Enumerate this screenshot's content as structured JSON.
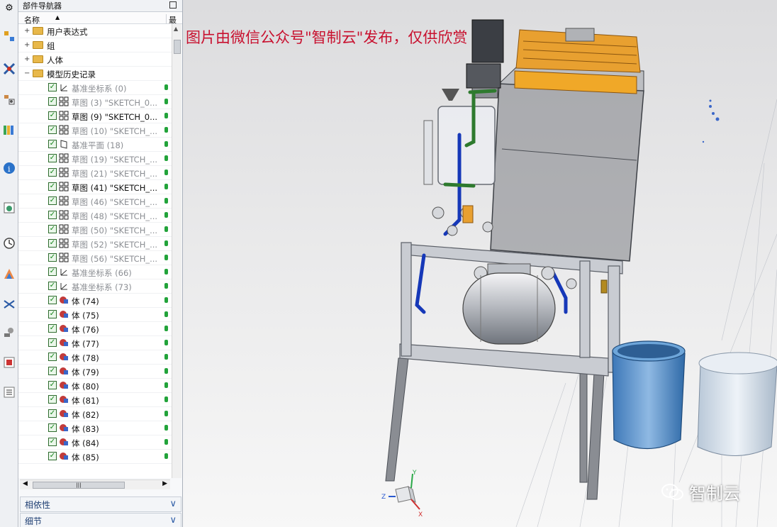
{
  "navigator": {
    "title": "部件导航器",
    "col_name": "名称",
    "col_latest": "最新",
    "top_items": [
      {
        "label": "用户表达式",
        "exp": "+"
      },
      {
        "label": "组",
        "exp": "+"
      },
      {
        "label": "人体",
        "exp": "+"
      },
      {
        "label": "模型历史记录",
        "exp": "−"
      }
    ],
    "history": [
      {
        "label": "基准坐标系 (0)",
        "type": "csys",
        "dim": true
      },
      {
        "label": "草图 (3) \"SKETCH_0...",
        "type": "sketch",
        "dim": true
      },
      {
        "label": "草图 (9) \"SKETCH_0...",
        "type": "sketch",
        "dim": false
      },
      {
        "label": "草图 (10) \"SKETCH_...",
        "type": "sketch",
        "dim": true
      },
      {
        "label": "基准平面 (18)",
        "type": "plane",
        "dim": true
      },
      {
        "label": "草图 (19) \"SKETCH_...",
        "type": "sketch",
        "dim": true
      },
      {
        "label": "草图 (21) \"SKETCH_...",
        "type": "sketch",
        "dim": true
      },
      {
        "label": "草图 (41) \"SKETCH_...",
        "type": "sketch",
        "dim": false
      },
      {
        "label": "草图 (46) \"SKETCH_...",
        "type": "sketch",
        "dim": true
      },
      {
        "label": "草图 (48) \"SKETCH_...",
        "type": "sketch",
        "dim": true
      },
      {
        "label": "草图 (50) \"SKETCH_...",
        "type": "sketch",
        "dim": true
      },
      {
        "label": "草图 (52) \"SKETCH_...",
        "type": "sketch",
        "dim": true
      },
      {
        "label": "草图 (56) \"SKETCH_...",
        "type": "sketch",
        "dim": true
      },
      {
        "label": "基准坐标系 (66)",
        "type": "csys",
        "dim": true
      },
      {
        "label": "基准坐标系 (73)",
        "type": "csys",
        "dim": true
      },
      {
        "label": "体 (74)",
        "type": "body",
        "dim": false
      },
      {
        "label": "体 (75)",
        "type": "body",
        "dim": false
      },
      {
        "label": "体 (76)",
        "type": "body",
        "dim": false
      },
      {
        "label": "体 (77)",
        "type": "body",
        "dim": false
      },
      {
        "label": "体 (78)",
        "type": "body",
        "dim": false
      },
      {
        "label": "体 (79)",
        "type": "body",
        "dim": false
      },
      {
        "label": "体 (80)",
        "type": "body",
        "dim": false
      },
      {
        "label": "体 (81)",
        "type": "body",
        "dim": false
      },
      {
        "label": "体 (82)",
        "type": "body",
        "dim": false
      },
      {
        "label": "体 (83)",
        "type": "body",
        "dim": false
      },
      {
        "label": "体 (84)",
        "type": "body",
        "dim": false
      },
      {
        "label": "体 (85)",
        "type": "body",
        "dim": false
      }
    ],
    "sections": {
      "dependencies": "相依性",
      "details": "细节"
    }
  },
  "watermark": "图片由微信公众号\"智制云\"发布，仅供欣赏",
  "brand": "智制云",
  "triad": {
    "x": "X",
    "y": "Y",
    "z": "Z"
  },
  "icons": {
    "resource_bar": [
      "gear-icon",
      "assembly-navigator-icon",
      "constraint-navigator-icon",
      "part-navigator-icon",
      "reuse-library-icon",
      "info-icon",
      "web-browser-icon",
      "history-icon",
      "system-materials-icon",
      "process-studio-icon",
      "manufacturing-wizard-icon",
      "roles-icon",
      "properties-icon"
    ]
  },
  "colors": {
    "watermark": "#c8102e",
    "section_text": "#1f3f73",
    "check_green": "#15841a"
  }
}
